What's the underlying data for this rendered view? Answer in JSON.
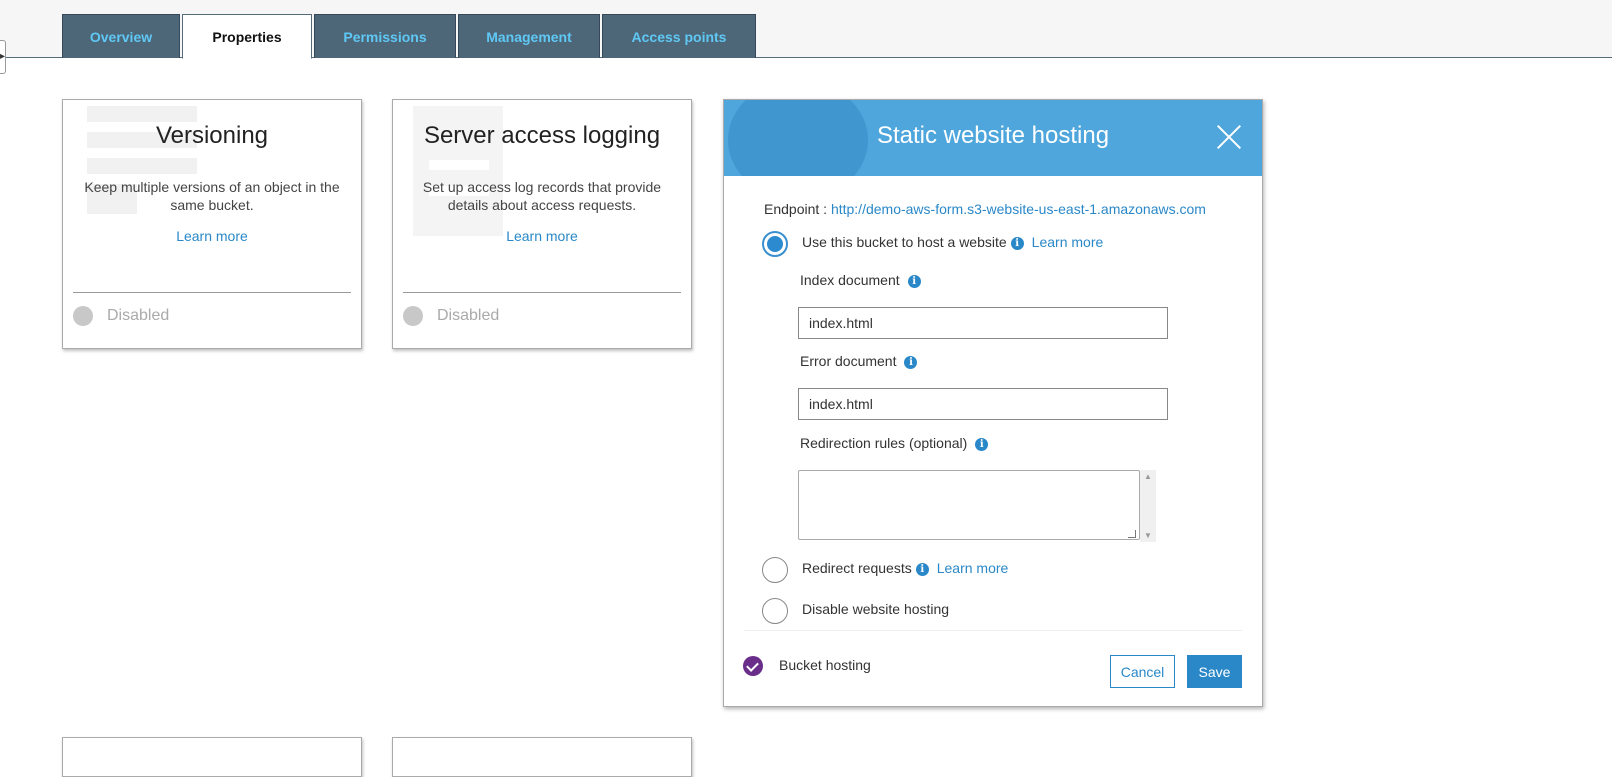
{
  "tabs": [
    {
      "label": "Overview"
    },
    {
      "label": "Properties"
    },
    {
      "label": "Permissions"
    },
    {
      "label": "Management"
    },
    {
      "label": "Access points"
    }
  ],
  "cards": {
    "versioning": {
      "title": "Versioning",
      "description": "Keep multiple versions of an object in the same bucket.",
      "learn_more": "Learn more",
      "status": "Disabled"
    },
    "logging": {
      "title": "Server access logging",
      "description": "Set up access log records that provide details about access requests.",
      "learn_more": "Learn more",
      "status": "Disabled"
    }
  },
  "hosting": {
    "title": "Static website hosting",
    "endpoint_label": "Endpoint : ",
    "endpoint_url": "http://demo-aws-form.s3-website-us-east-1.amazonaws.com",
    "option_host": "Use this bucket to host a website",
    "option_host_learn": "Learn more",
    "index_label": "Index document",
    "index_value": "index.html",
    "error_label": "Error document",
    "error_value": "index.html",
    "redirection_label": "Redirection rules (optional)",
    "redirection_value": "",
    "option_redirect": "Redirect requests",
    "option_redirect_learn": "Learn more",
    "option_disable": "Disable website hosting",
    "footer_label": "Bucket hosting",
    "cancel": "Cancel",
    "save": "Save",
    "info_glyph": "i",
    "header_color": "#4ea6dc",
    "accent_color": "#2a88c8"
  }
}
